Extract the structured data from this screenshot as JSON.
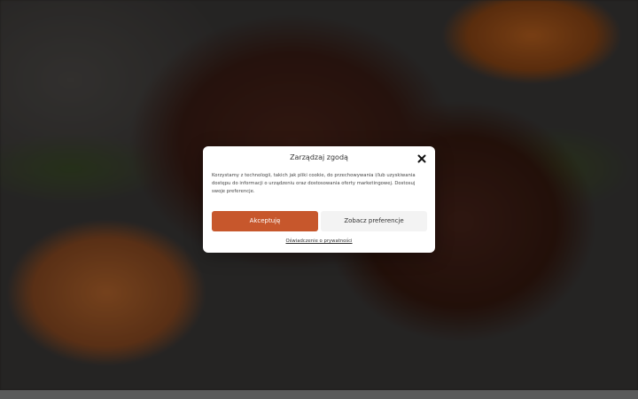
{
  "consent_modal": {
    "title": "Zarządzaj zgodą",
    "close_icon": "close-icon",
    "body_text": "Korzystamy z technologii, takich jak pliki cookie, do przechowywania i/lub uzyskiwania dostępu do informacji o urządzeniu oraz dostosowania oferty marketingowej. Dostosuj swoje preferencje.",
    "accept_label": "Akceptuję",
    "preferences_label": "Zobacz preferencje",
    "privacy_link_label": "Oświadczenie o prywatności"
  },
  "colors": {
    "accent": "#c7572c",
    "secondary_button": "#f3f3f3"
  }
}
